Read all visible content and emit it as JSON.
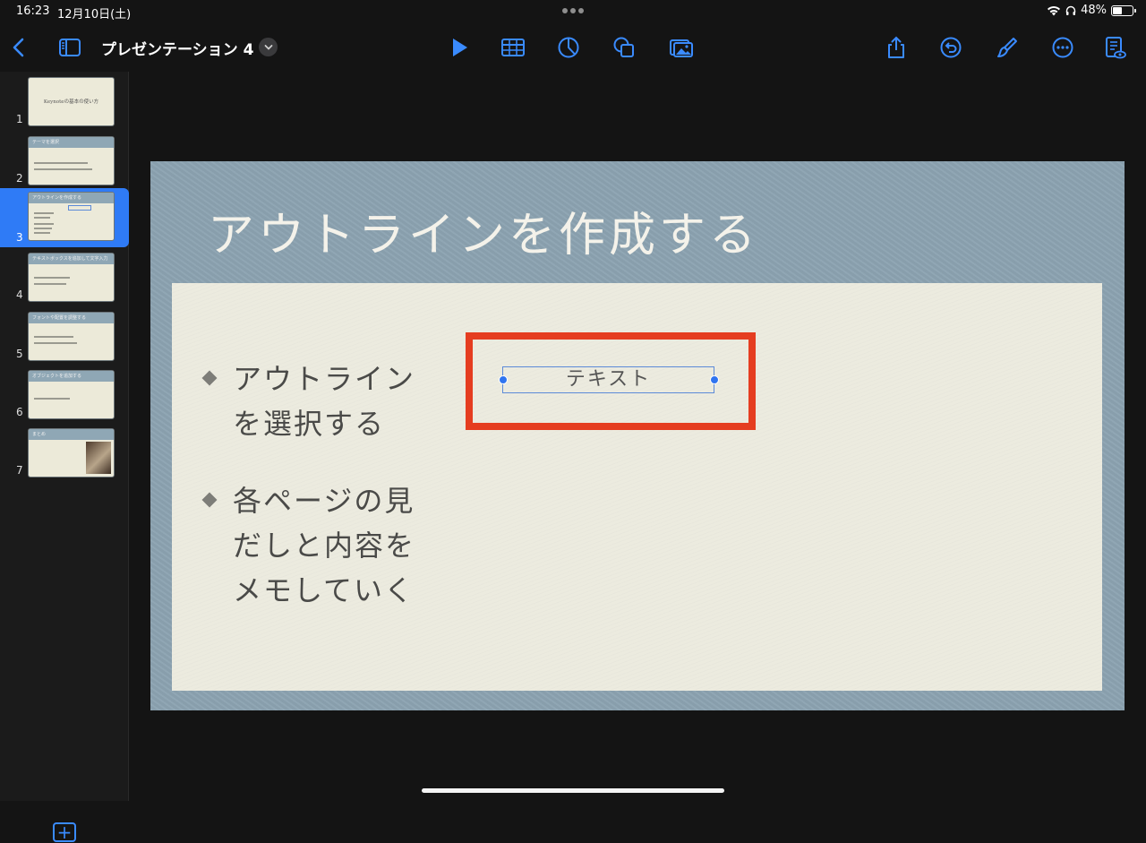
{
  "status_bar": {
    "time": "16:23",
    "date": "12月10日(土)",
    "battery": "48%",
    "battery_level": 0.48
  },
  "toolbar": {
    "doc_title": "プレゼンテーション 4",
    "icons": [
      "back-icon",
      "navigator-icon",
      "chevron-down-icon",
      "play-icon",
      "table-icon",
      "chart-icon",
      "shape-icon",
      "media-icon",
      "share-icon",
      "undo-icon",
      "format-brush-icon",
      "more-icon",
      "presenter-notes-icon"
    ],
    "accent": "#3a8bff"
  },
  "navigator": {
    "selected": 3,
    "slides": [
      {
        "num": "1",
        "title": "Keynoteの基本の使い方"
      },
      {
        "num": "2",
        "title": "テーマを選択"
      },
      {
        "num": "3",
        "title": "アウトラインを作成する"
      },
      {
        "num": "4",
        "title": "テキストボックスを追加して文字入力"
      },
      {
        "num": "5",
        "title": "フォントや配置を調整する"
      },
      {
        "num": "6",
        "title": "オブジェクトを追加する"
      },
      {
        "num": "7",
        "title": "まとめ"
      }
    ],
    "add_icon": "plus-square-icon"
  },
  "slide": {
    "title": "アウトラインを作成する",
    "bullets": [
      {
        "text": "アウトラインを選択する"
      },
      {
        "text": "各ページの見だしと内容をメモしていく"
      }
    ],
    "textbox": "テキスト",
    "highlight_color": "#e53d20"
  }
}
